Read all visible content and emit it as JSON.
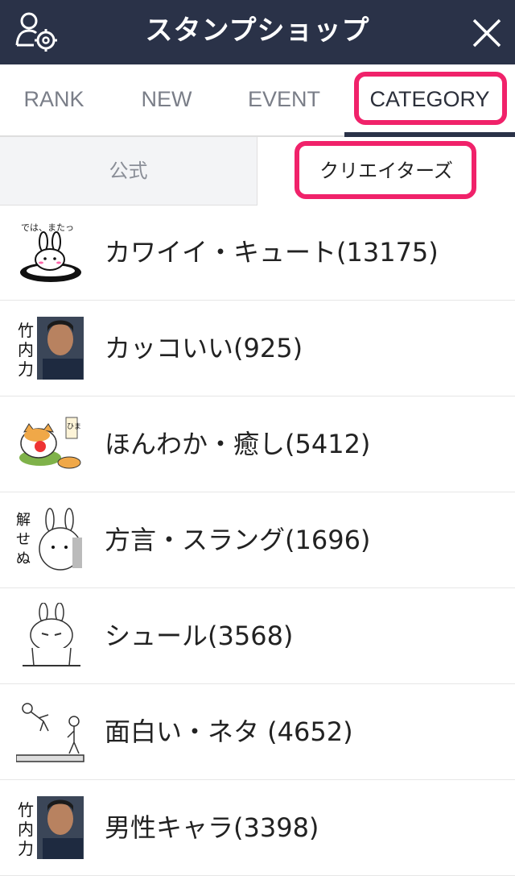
{
  "header": {
    "title": "スタンプショップ"
  },
  "tabs": [
    {
      "label": "RANK"
    },
    {
      "label": "NEW"
    },
    {
      "label": "EVENT"
    },
    {
      "label": "CATEGORY",
      "active": true
    }
  ],
  "subtabs": [
    {
      "label": "公式"
    },
    {
      "label": "クリエイターズ",
      "active": true
    }
  ],
  "categories": [
    {
      "label": "カワイイ・キュート(13175)",
      "icon": "bunny-sticker-icon",
      "thumb_text": "では、またっ"
    },
    {
      "label": "カッコいい(925)",
      "icon": "man-photo-sticker-icon",
      "thumb_text": "竹内力"
    },
    {
      "label": "ほんわか・癒し(5412)",
      "icon": "cats-sticker-icon",
      "thumb_text": "ひま"
    },
    {
      "label": "方言・スラング(1696)",
      "icon": "rabbit-dialect-sticker-icon",
      "thumb_text": "解せぬ"
    },
    {
      "label": "シュール(3568)",
      "icon": "surreal-rabbit-sticker-icon",
      "thumb_text": ""
    },
    {
      "label": "面白い・ネタ (4652)",
      "icon": "stick-figures-sticker-icon",
      "thumb_text": ""
    },
    {
      "label": "男性キャラ(3398)",
      "icon": "man-photo-sticker-icon",
      "thumb_text": "竹内力"
    }
  ],
  "colors": {
    "header_bg": "#2a3248",
    "highlight": "#f0226a",
    "tab_inactive": "#7a7e88"
  }
}
